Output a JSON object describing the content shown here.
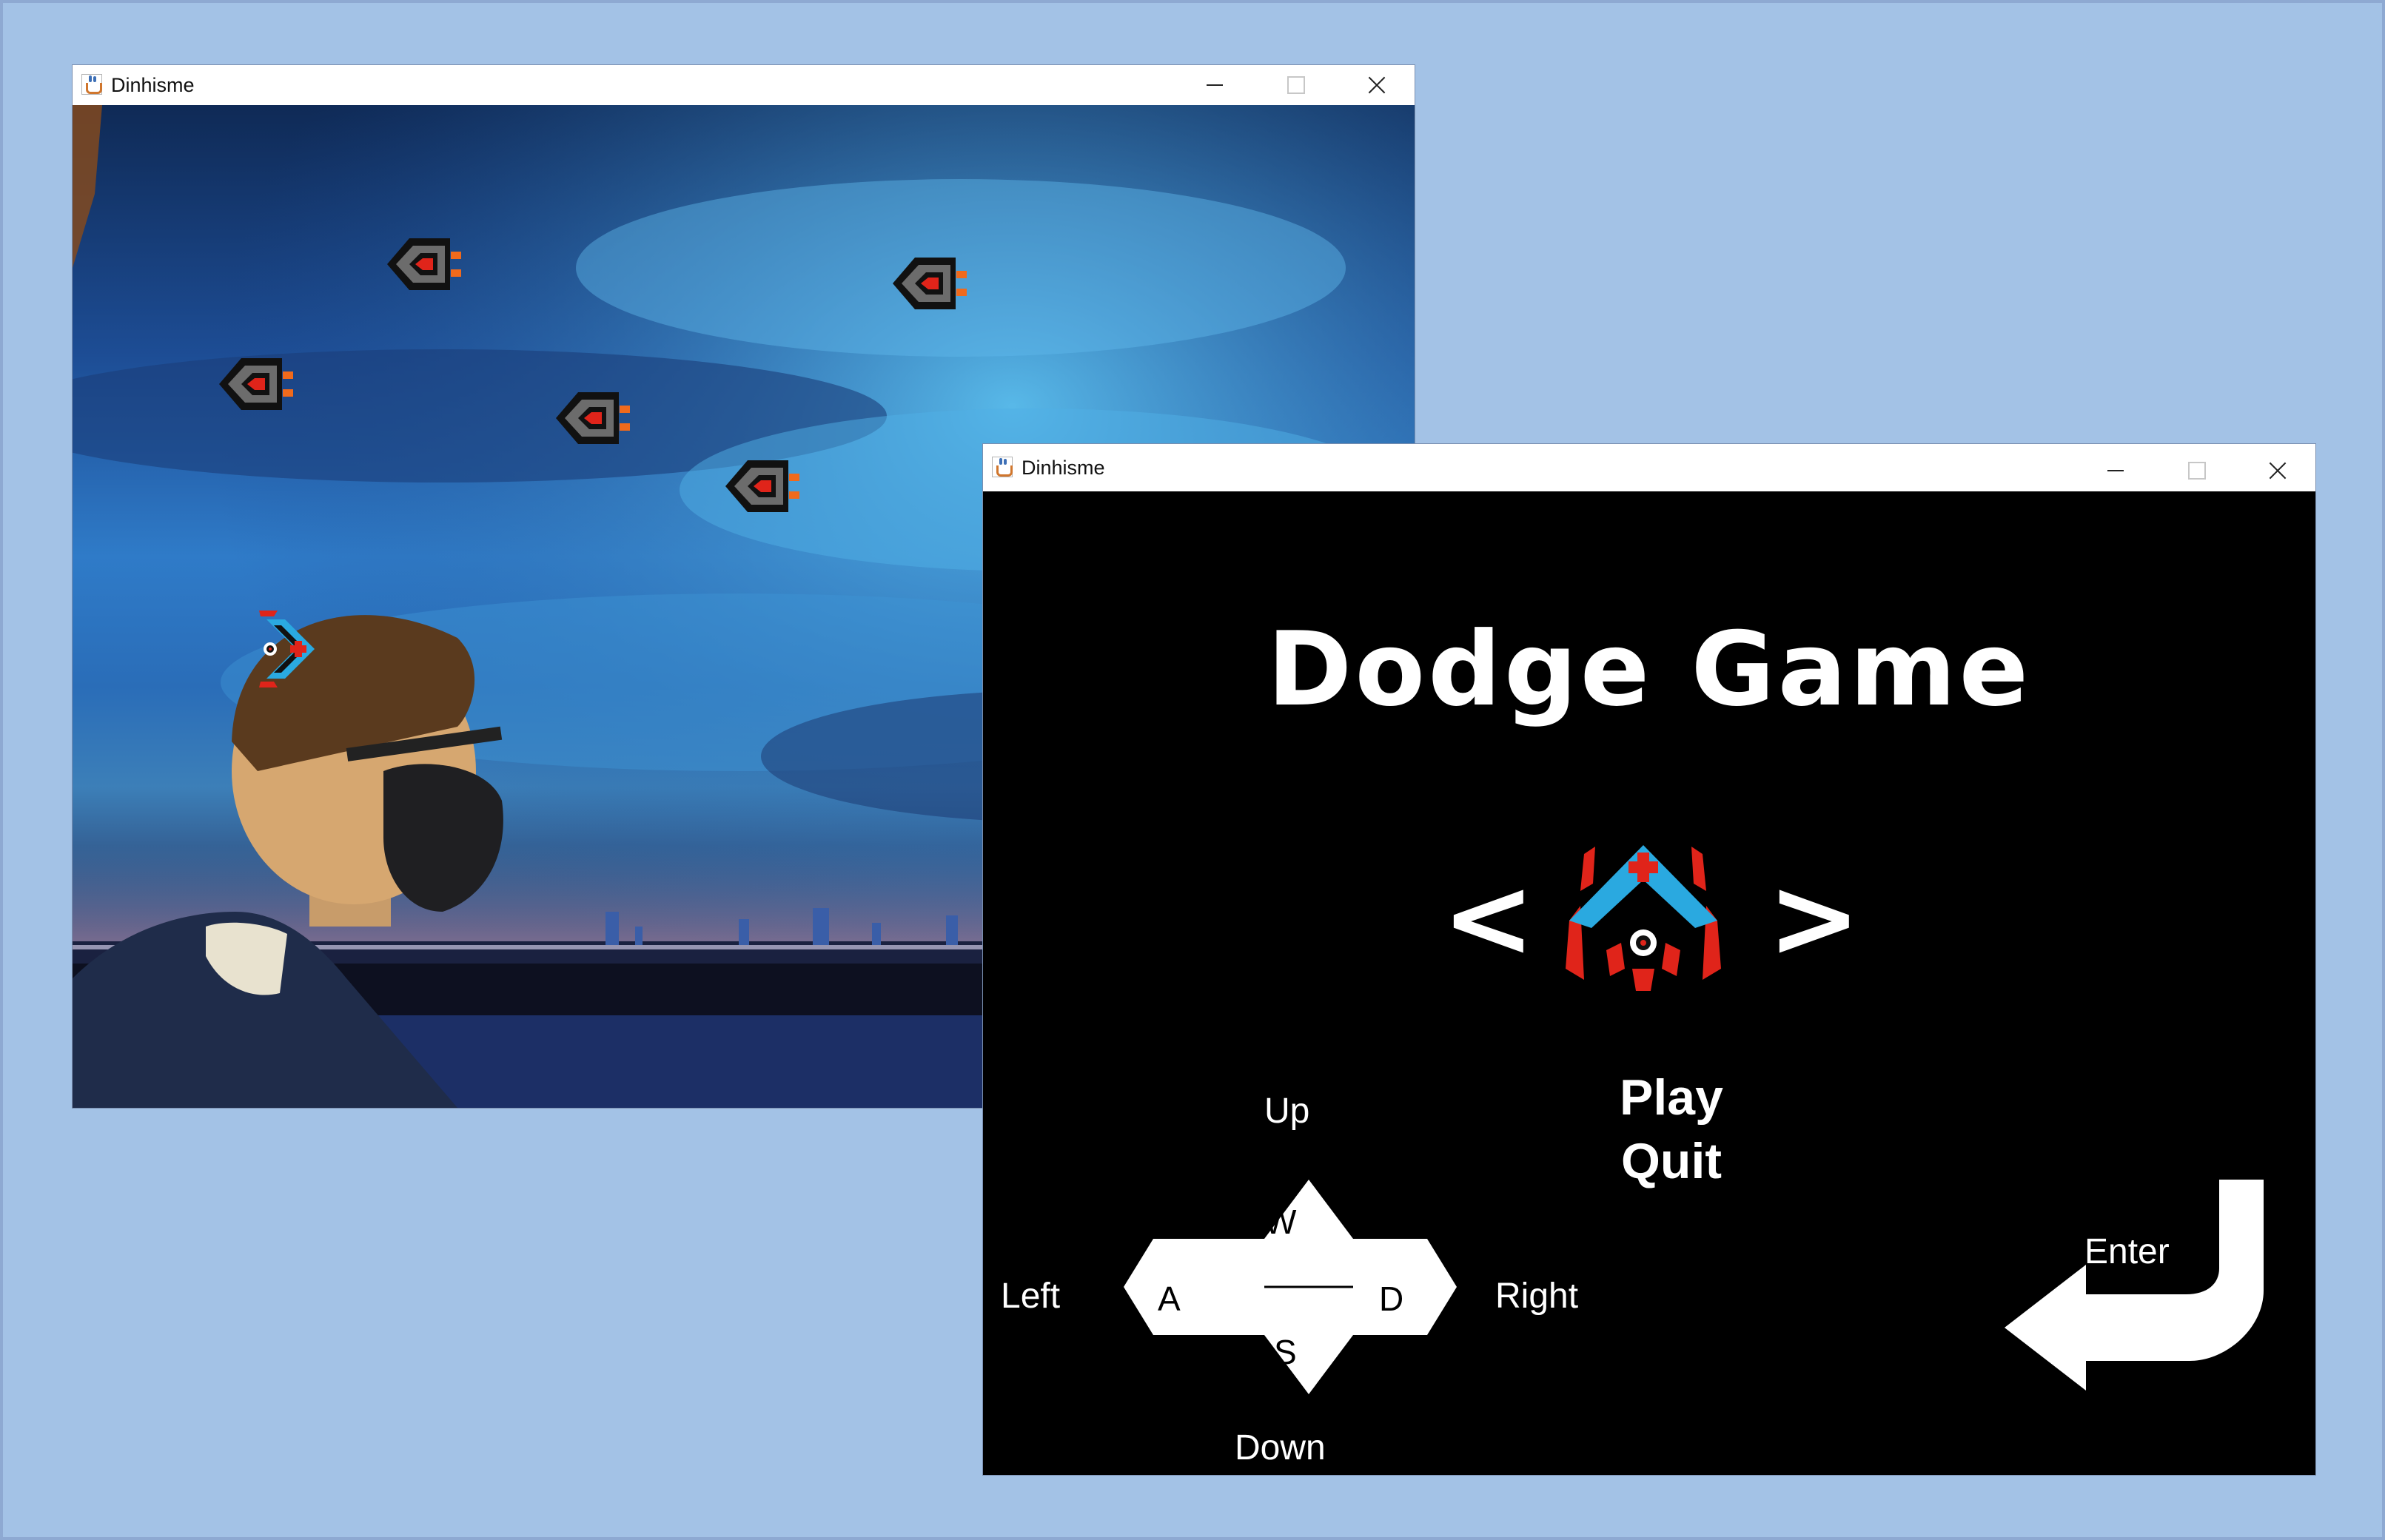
{
  "gameplay_window": {
    "title": "Dinhisme",
    "icon": "java-cup-icon",
    "enemy_count": 6,
    "player": "player-ship"
  },
  "menu_window": {
    "title": "Dinhisme",
    "icon": "java-cup-icon",
    "game_title": "Dodge Game",
    "prev_arrow": "<",
    "next_arrow": ">",
    "menu_items": [
      "Play",
      "Quit"
    ],
    "controls": {
      "up": "Up",
      "down": "Down",
      "left": "Left",
      "right": "Right",
      "w": "W",
      "a": "A",
      "s": "S",
      "d": "D",
      "enter": "Enter"
    }
  },
  "colors": {
    "background": "#a3c2e6",
    "ship_cyan": "#2aa9e0",
    "ship_red": "#e0241a"
  }
}
